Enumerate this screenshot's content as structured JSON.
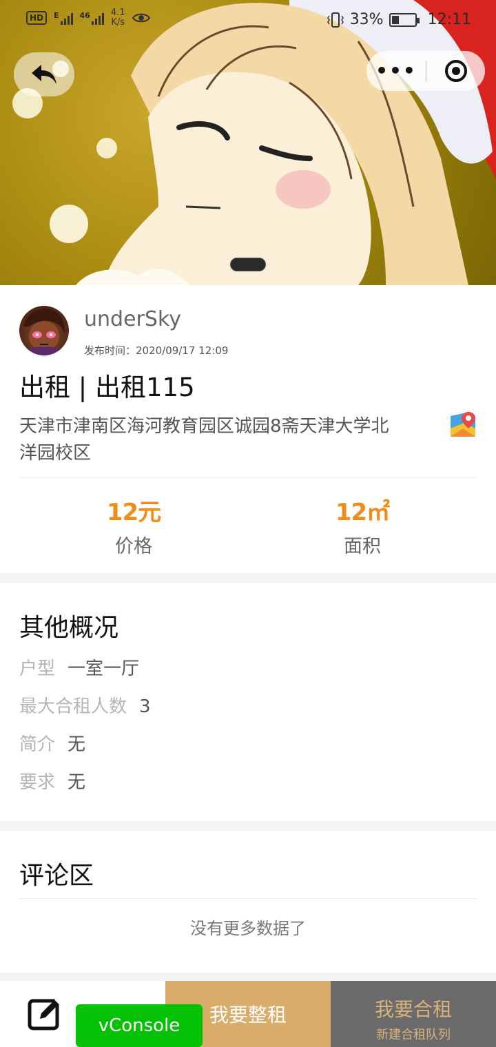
{
  "status_bar": {
    "hd_label": "HD",
    "network_e": "E",
    "network_4g": "46",
    "speed_value": "4.1",
    "speed_unit": "K/s",
    "battery": "33%",
    "time": "12:11"
  },
  "nav": {
    "back_icon": "back-arrow-icon",
    "more_label": "•••",
    "close_icon": "target-icon"
  },
  "post": {
    "username": "underSky",
    "published_label": "发布时间：",
    "published_time": "2020/09/17 12:09",
    "title": "出租 | 出租115",
    "address": "天津市津南区海河教育园区诚园8斋天津大学北洋园校区",
    "price_value": "12元",
    "price_label": "价格",
    "area_value": "12㎡",
    "area_label": "面积"
  },
  "overview": {
    "title": "其他概况",
    "rows": [
      {
        "key": "户型",
        "value": "一室一厅"
      },
      {
        "key": "最大合租人数",
        "value": "3"
      },
      {
        "key": "简介",
        "value": "无"
      },
      {
        "key": "要求",
        "value": "无"
      }
    ]
  },
  "comments": {
    "title": "评论区",
    "empty_text": "没有更多数据了"
  },
  "bottom_bar": {
    "rent_whole": "我要整租",
    "rent_share": "我要合租",
    "rent_share_sub": "新建合租队列"
  },
  "vconsole_label": "vConsole",
  "colors": {
    "accent_orange": "#f08c1a",
    "rent_whole_bg": "#d9ad69",
    "rent_share_bg": "#6b6b6b",
    "vconsole_green": "#06c206"
  }
}
